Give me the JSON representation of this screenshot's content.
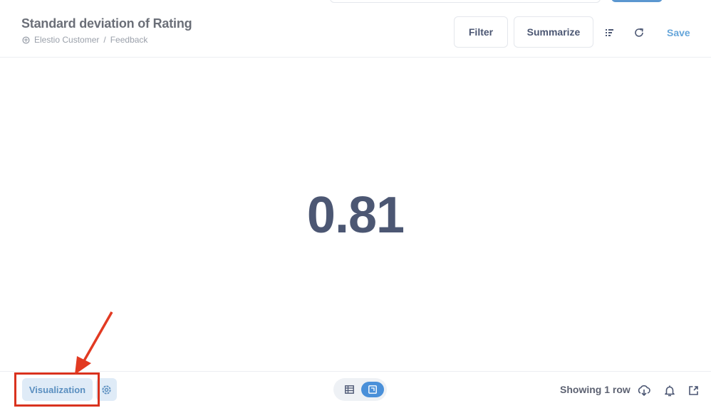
{
  "header": {
    "title": "Standard deviation of Rating",
    "breadcrumb": {
      "database_icon": "database-icon",
      "database": "Elestio Customer",
      "separator": "/",
      "table": "Feedback"
    },
    "actions": {
      "filter_label": "Filter",
      "summarize_label": "Summarize",
      "notebook_icon": "list-icon",
      "refresh_icon": "refresh-icon",
      "save_label": "Save"
    }
  },
  "main": {
    "scalar_value": "0.81"
  },
  "footer": {
    "visualization_label": "Visualization",
    "settings_icon": "gear-icon",
    "view_toggle": {
      "options": [
        "table",
        "visualization"
      ],
      "selected": "visualization"
    },
    "row_count": "Showing 1 row",
    "download_icon": "cloud-download-icon",
    "alert_icon": "bell-icon",
    "share_icon": "external-link-icon"
  },
  "annotation": {
    "color": "#d9321e",
    "target": "Visualization"
  },
  "colors": {
    "accent": "#509ee3",
    "text": "#4c5773",
    "annotation": "#d9321e"
  }
}
